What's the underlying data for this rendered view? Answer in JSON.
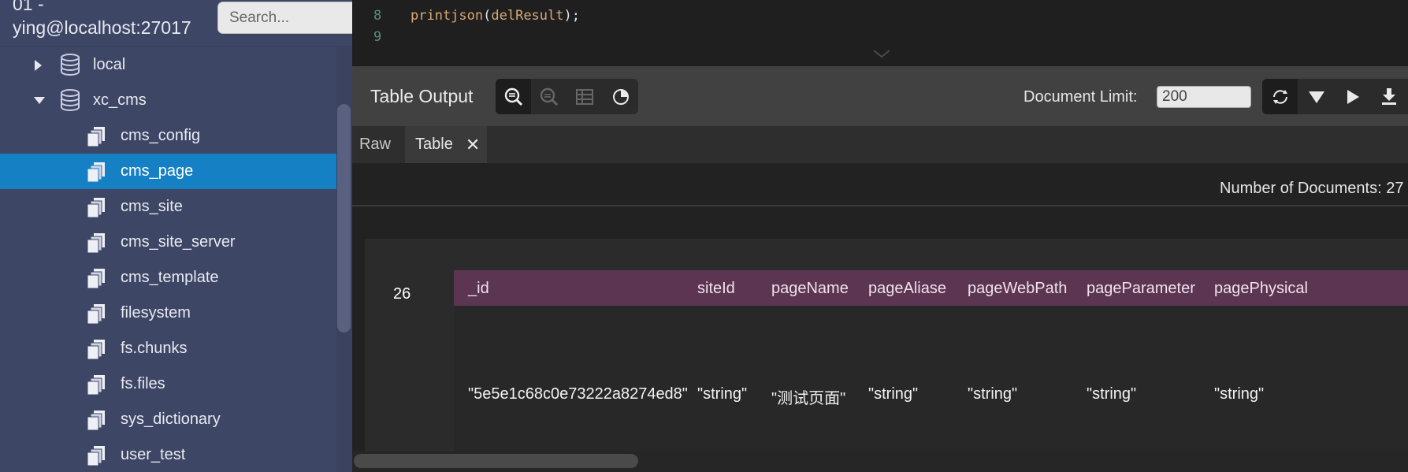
{
  "sidebar": {
    "connection_line1": "01 -",
    "connection_line2": "ying@localhost:27017",
    "search_placeholder": "Search...",
    "databases": [
      {
        "label": "local",
        "expanded": false
      },
      {
        "label": "xc_cms",
        "expanded": true
      }
    ],
    "collections": [
      {
        "label": "cms_config",
        "selected": false
      },
      {
        "label": "cms_page",
        "selected": true
      },
      {
        "label": "cms_site",
        "selected": false
      },
      {
        "label": "cms_site_server",
        "selected": false
      },
      {
        "label": "cms_template",
        "selected": false
      },
      {
        "label": "filesystem",
        "selected": false
      },
      {
        "label": "fs.chunks",
        "selected": false
      },
      {
        "label": "fs.files",
        "selected": false
      },
      {
        "label": "sys_dictionary",
        "selected": false
      },
      {
        "label": "user_test",
        "selected": false
      }
    ]
  },
  "editor": {
    "lines": [
      {
        "number": "8",
        "fn": "printjson",
        "open": "(",
        "arg": "delResult",
        "close": ");"
      },
      {
        "number": "9"
      }
    ]
  },
  "output": {
    "title": "Table Output",
    "document_limit_label": "Document Limit:",
    "document_limit_value": "200",
    "tabs": [
      {
        "label": "Raw",
        "active": false
      },
      {
        "label": "Table",
        "active": true,
        "close": "✕"
      }
    ],
    "doc_count": "Number of Documents: 27",
    "table": {
      "row_index": "26",
      "columns": [
        "_id",
        "siteId",
        "pageName",
        "pageAliase",
        "pageWebPath",
        "pageParameter",
        "pagePhysical"
      ],
      "row": [
        "\"5e5e1c68c0e73222a8274ed8\"",
        "\"string\"",
        "\"测试页面\"",
        "\"string\"",
        "\"string\"",
        "\"string\"",
        "\"string\""
      ]
    }
  },
  "colors": {
    "sidebar_bg": "#3e4666",
    "selected_bg": "#1580c4",
    "header_bg": "#5c3552",
    "toolbar_bg": "#414141"
  },
  "icons": {
    "database": "database-icon",
    "collection": "collection-icon",
    "tree_view": "tree-view-icon",
    "search": "search-icon",
    "table_view": "table-view-icon",
    "chart": "chart-icon",
    "refresh": "refresh-icon",
    "filter": "filter-icon",
    "run": "play-icon",
    "export": "download-icon"
  }
}
